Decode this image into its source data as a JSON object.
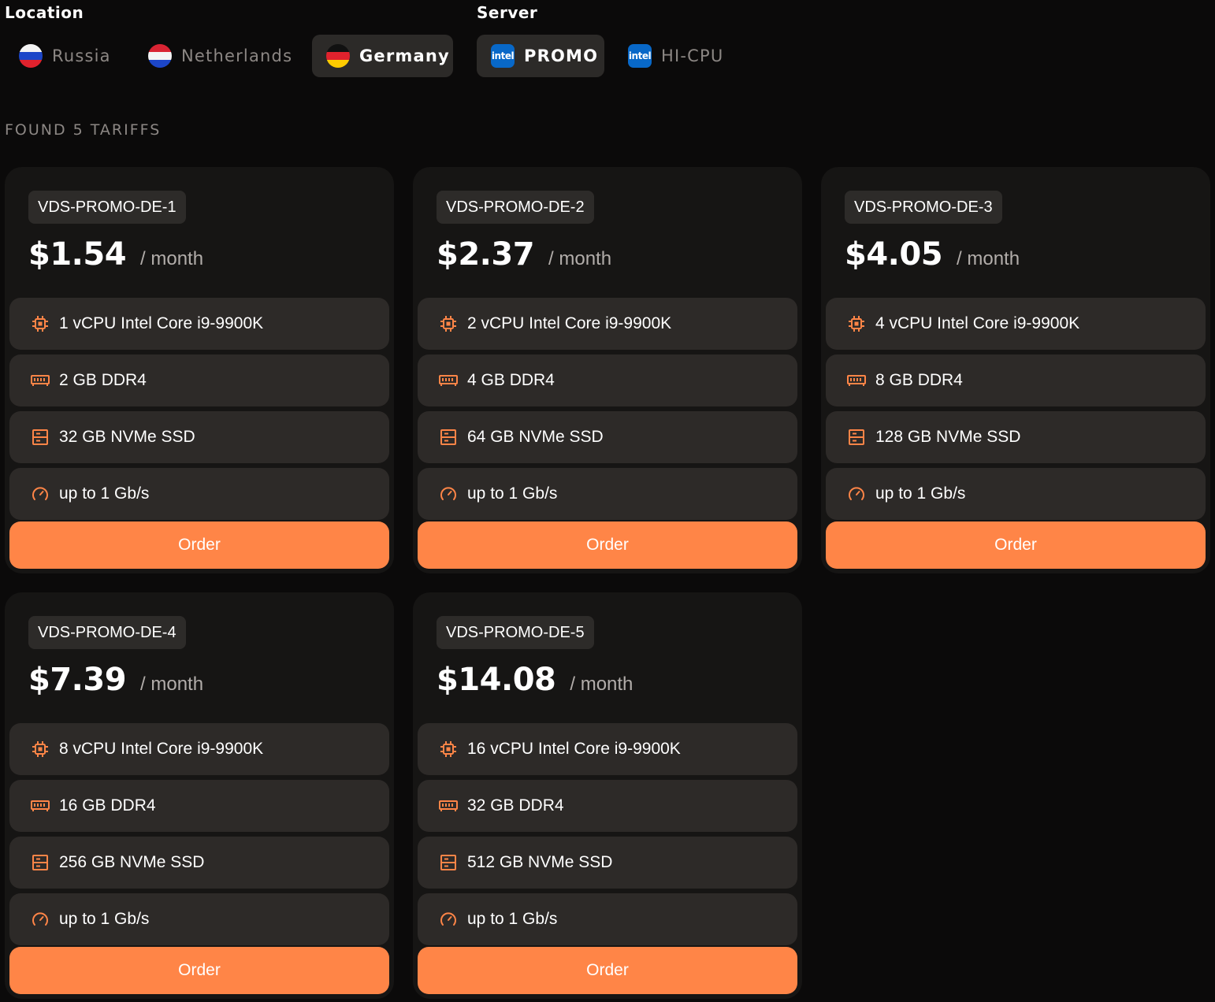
{
  "filters": {
    "location_label": "Location",
    "server_label": "Server",
    "locations": [
      {
        "label": "Russia",
        "active": false
      },
      {
        "label": "Netherlands",
        "active": false
      },
      {
        "label": "Germany",
        "active": true
      }
    ],
    "servers": [
      {
        "label": "PROMO",
        "icon_text": "intel",
        "active": true
      },
      {
        "label": "HI-CPU",
        "icon_text": "intel",
        "active": false
      }
    ]
  },
  "found_text": "FOUND 5 TARIFFS",
  "colors": {
    "accent": "#ff8547",
    "card": "#161514",
    "spec": "#2d2a28",
    "intel": "#0868c8"
  },
  "tariffs": [
    {
      "name": "VDS-PROMO-DE-1",
      "price": "$1.54",
      "period": "/ month",
      "cpu": "1 vCPU Intel Core i9-9900K",
      "ram": "2 GB DDR4",
      "disk": "32 GB NVMe SSD",
      "net": "up to 1 Gb/s",
      "order": "Order"
    },
    {
      "name": "VDS-PROMO-DE-2",
      "price": "$2.37",
      "period": "/ month",
      "cpu": "2 vCPU Intel Core i9-9900K",
      "ram": "4 GB DDR4",
      "disk": "64 GB NVMe SSD",
      "net": "up to 1 Gb/s",
      "order": "Order"
    },
    {
      "name": "VDS-PROMO-DE-3",
      "price": "$4.05",
      "period": "/ month",
      "cpu": "4 vCPU Intel Core i9-9900K",
      "ram": "8 GB DDR4",
      "disk": "128 GB NVMe SSD",
      "net": "up to 1 Gb/s",
      "order": "Order"
    },
    {
      "name": "VDS-PROMO-DE-4",
      "price": "$7.39",
      "period": "/ month",
      "cpu": "8 vCPU Intel Core i9-9900K",
      "ram": "16 GB DDR4",
      "disk": "256 GB NVMe SSD",
      "net": "up to 1 Gb/s",
      "order": "Order"
    },
    {
      "name": "VDS-PROMO-DE-5",
      "price": "$14.08",
      "period": "/ month",
      "cpu": "16 vCPU Intel Core i9-9900K",
      "ram": "32 GB DDR4",
      "disk": "512 GB NVMe SSD",
      "net": "up to 1 Gb/s",
      "order": "Order"
    }
  ]
}
